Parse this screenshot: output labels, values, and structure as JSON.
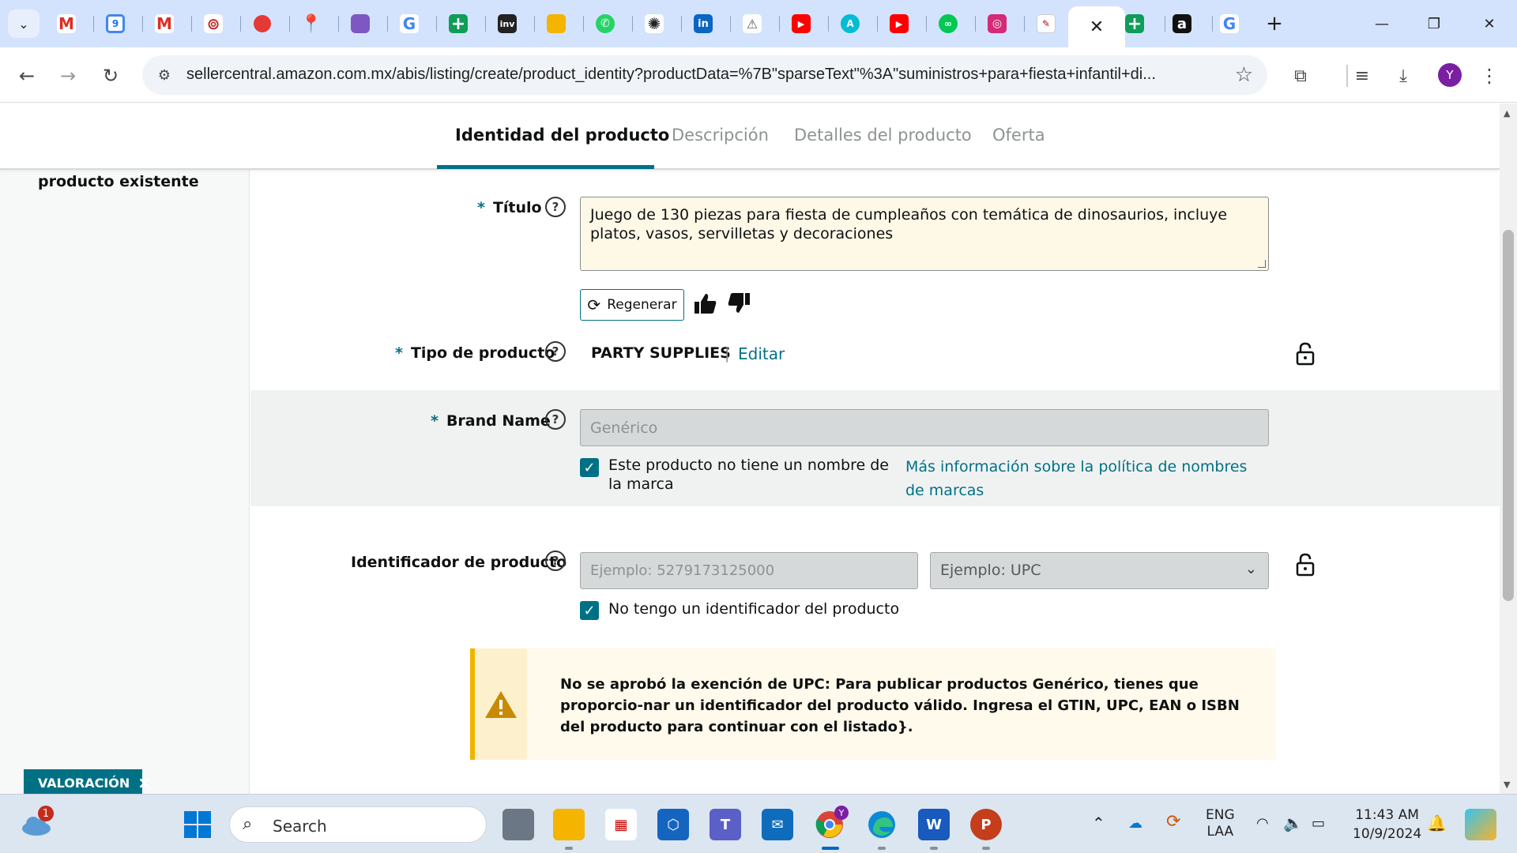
{
  "browser": {
    "tab_icons": [
      "gmail-icon",
      "google-calendar-icon",
      "gmail-icon",
      "app-icon",
      "opera-icon",
      "google-maps-icon",
      "printer-icon",
      "google-icon",
      "google-sheets-icon",
      "inv-icon",
      "slides-icon",
      "whatsapp-icon",
      "chatgpt-icon",
      "linkedin-icon",
      "document-icon",
      "youtube-icon",
      "ai-icon",
      "youtube-icon",
      "app-icon",
      "instagram-icon",
      "document-icon"
    ],
    "inv_label": "inv",
    "linkedin_label": "in",
    "calendar_label": "9",
    "amazon_tab_label": "a",
    "url": "sellercentral.amazon.com.mx/abis/listing/create/product_identity?productData=%7B\"sparseText\"%3A\"suministros+para+fiesta+infantil+di...",
    "profile_initial": "Y"
  },
  "steps": [
    {
      "label": "Identidad del producto",
      "active": true
    },
    {
      "label": "Descripción",
      "active": false
    },
    {
      "label": "Detalles del producto",
      "active": false
    },
    {
      "label": "Oferta",
      "active": false
    }
  ],
  "sidebar": {
    "label": "producto existente"
  },
  "form": {
    "title": {
      "label": "Título",
      "value": "Juego de 130 piezas para fiesta de cumpleaños con temática de dinosaurios, incluye platos, vasos, servilletas y decoraciones",
      "regenerate_label": "Regenerar"
    },
    "product_type": {
      "label": "Tipo de producto",
      "value": "PARTY SUPPLIES",
      "separator": "|",
      "edit_label": "Editar"
    },
    "brand": {
      "label": "Brand Name",
      "placeholder": "Genérico",
      "no_brand_checkbox_label": "Este producto no tiene un nombre de la marca",
      "no_brand_checked": true,
      "policy_link": "Más información sobre la política de nombres de marcas"
    },
    "identifier": {
      "label": "Identificador de producto",
      "placeholder": "Ejemplo: 5279173125000",
      "type_select_value": "Ejemplo: UPC",
      "no_id_checkbox_label": "No tengo un identificador del producto",
      "no_id_checked": true
    },
    "alert": {
      "message": "No se aprobó la exención de UPC: Para publicar productos Genérico, tienes que proporcio-nar un identificador del producto válido. Ingresa el GTIN, UPC, EAN o ISBN del producto para continuar con el listado}."
    },
    "required_mark": "*"
  },
  "feedback_badge": {
    "label": "VALORACIÓN",
    "close": "×"
  },
  "taskbar": {
    "search_placeholder": "Search",
    "weather_badge": "1",
    "chrome_badge": "Y",
    "teams_label": "T",
    "word_label": "W",
    "powerpoint_label": "P",
    "language_line1": "ENG",
    "language_line2": "LAA",
    "time": "11:43 AM",
    "date": "10/9/2024"
  },
  "colors": {
    "accent": "#007185",
    "tabbar_bg": "#d3e3fd",
    "alert_border": "#f0b400"
  }
}
